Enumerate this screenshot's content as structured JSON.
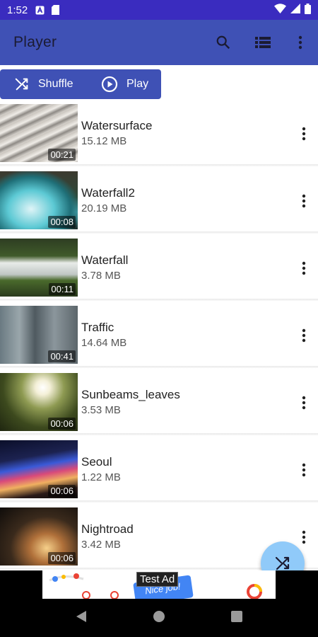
{
  "status_bar": {
    "time": "1:52"
  },
  "app_bar": {
    "title": "Player"
  },
  "chips": {
    "shuffle_label": "Shuffle",
    "play_label": "Play"
  },
  "videos": [
    {
      "title": "Watersurface",
      "size": "15.12 MB",
      "duration": "00:21"
    },
    {
      "title": "Waterfall2",
      "size": "20.19 MB",
      "duration": "00:08"
    },
    {
      "title": "Waterfall",
      "size": "3.78 MB",
      "duration": "00:11"
    },
    {
      "title": "Traffic",
      "size": "14.64 MB",
      "duration": "00:41"
    },
    {
      "title": "Sunbeams_leaves",
      "size": "3.53 MB",
      "duration": "00:06"
    },
    {
      "title": "Seoul",
      "size": "1.22 MB",
      "duration": "00:06"
    },
    {
      "title": "Nightroad",
      "size": "3.42 MB",
      "duration": "00:06"
    }
  ],
  "ad": {
    "label": "Test Ad",
    "banner_text": "Nice job!"
  },
  "colors": {
    "status_bar": "#3a2cbf",
    "app_bar": "#3f51b5",
    "fab": "#90caf9"
  },
  "icons": {
    "search": "search-icon",
    "list": "view-list-icon",
    "overflow": "more-vert-icon",
    "shuffle": "shuffle-icon",
    "play": "play-circle-icon",
    "nav_back": "back-icon",
    "nav_home": "home-icon",
    "nav_recents": "recents-icon"
  }
}
